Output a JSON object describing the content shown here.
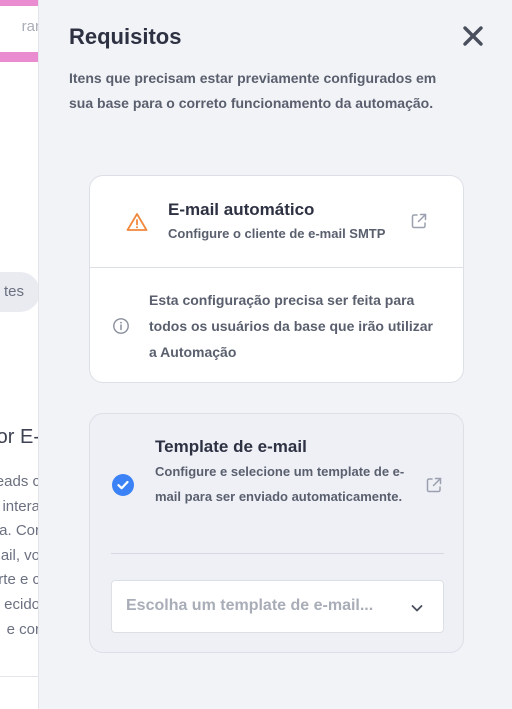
{
  "background": {
    "search_fragment": "rar",
    "chip_fragment": "tes",
    "heading_fragment": "or E-",
    "text_fragments": [
      "eads c",
      "intera",
      "a. Cor",
      "ail, vo",
      "arte e c",
      "ecido",
      "e cor"
    ]
  },
  "drawer": {
    "title": "Requisitos",
    "description": "Itens que precisam estar previamente configurados em sua base para o correto funcionamento da automação."
  },
  "email_card": {
    "title": "E-mail automático",
    "subtitle": "Configure o cliente de e-mail SMTP",
    "info": "Esta configuração precisa ser feita para todos os usuários da base que irão utilizar a Automação",
    "status_icon": "warning-icon",
    "status_color": "#f0883e"
  },
  "template_card": {
    "title": "Template de e-mail",
    "subtitle": "Configure e selecione um template de e-mail para ser enviado automaticamente.",
    "status_icon": "check-circle-icon",
    "status_color": "#3b82f6",
    "select": {
      "placeholder": "Escolha um template de e-mail..."
    }
  }
}
